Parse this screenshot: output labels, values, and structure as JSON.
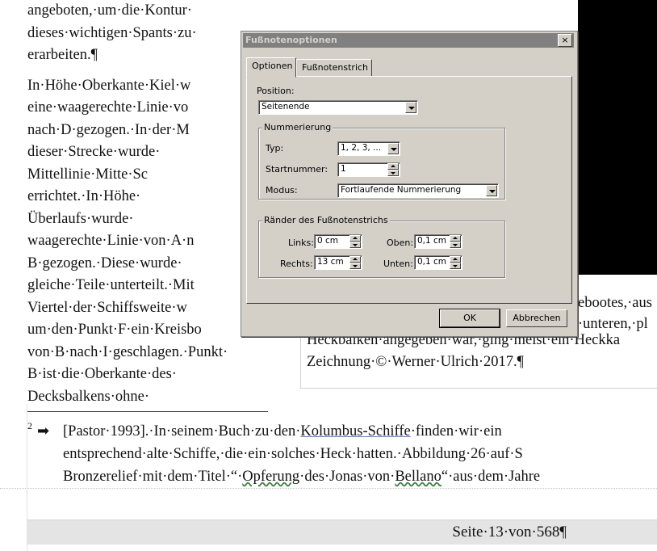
{
  "document": {
    "column_lines": [
      "angeboten,·um·die·Kontur·",
      "dieses·wichtigen·Spants·zu·",
      "erarbeiten.¶",
      "In·Höhe·Oberkante·Kiel·w",
      "eine·waagerechte·Linie·vo",
      "nach·D·gezogen.·In·der·M",
      "dieser·Strecke·wurde·",
      "Mittellinie·Mitte·Sc",
      "errichtet.·In·Höhe·",
      "Überlaufs·wurde·",
      "waagerechte·Linie·von·A·n",
      "B·gezogen.·Diese·wurde·",
      "gleiche·Teile·unterteilt.·Mit",
      "Viertel·der·Schiffsweite·w",
      "um·den·Punkt·F·ein·Kreisbo",
      "von·B·nach·I·geschlagen.·Punkt·",
      "B·ist·die·Oberkante·des·",
      "Decksbalkens·ohne·"
    ],
    "caption_right_lines": [
      "ebootes,·aus",
      "·unteren,·pl"
    ],
    "caption_lines": [
      "Heckbalken·angegeben·war,·ging·meist·ein·Heckka",
      "Zeichnung·©·Werner·Ulrich·2017.¶"
    ],
    "footnote": {
      "number": "2",
      "arrow": "➡",
      "line1_a": "[Pastor·1993].·In·seinem·Buch·zu·den·",
      "line1_link": "Kolumbus-Schiffe",
      "line1_b": "·finden·wir·ein",
      "line2": "entsprechend·alte·Schiffe,·die·ein·solches·Heck·hatten.·Abbildung·26·auf·S",
      "line3_a": "Bronzerelief·mit·dem·Titel·“·",
      "line3_w1": "Opferung",
      "line3_b": "·des·Jonas·von·",
      "line3_w2": "Bellano",
      "line3_c": "“·aus·dem·Jahre"
    },
    "page_footer": "Seite·13·von·568¶"
  },
  "dialog": {
    "title": "Fußnotenoptionen",
    "close": "×",
    "tabs": [
      {
        "label": "Optionen",
        "active": true
      },
      {
        "label": "Fußnotenstrich",
        "active": false
      }
    ],
    "position_label": "Position:",
    "position_value": "Seitenende",
    "numbering_group": "Nummerierung",
    "type_label": "Typ:",
    "type_value": "1, 2, 3, ...",
    "start_label": "Startnummer:",
    "start_value": "1",
    "mode_label": "Modus:",
    "mode_value": "Fortlaufende Nummerierung",
    "margins_group": "Ränder des Fußnotenstrichs",
    "left_label": "Links:",
    "left_value": "0 cm",
    "right_label": "Rechts:",
    "right_value": "13 cm",
    "top_label": "Oben:",
    "top_value": "0,1 cm",
    "bottom_label": "Unten:",
    "bottom_value": "0,1 cm",
    "ok": "OK",
    "cancel": "Abbrechen"
  },
  "colors": {
    "hull_green": "#2f9a5a",
    "hull_wood": "#c8a46a",
    "dialog_face": "#d4d0c8",
    "titlebar": "#808080"
  }
}
